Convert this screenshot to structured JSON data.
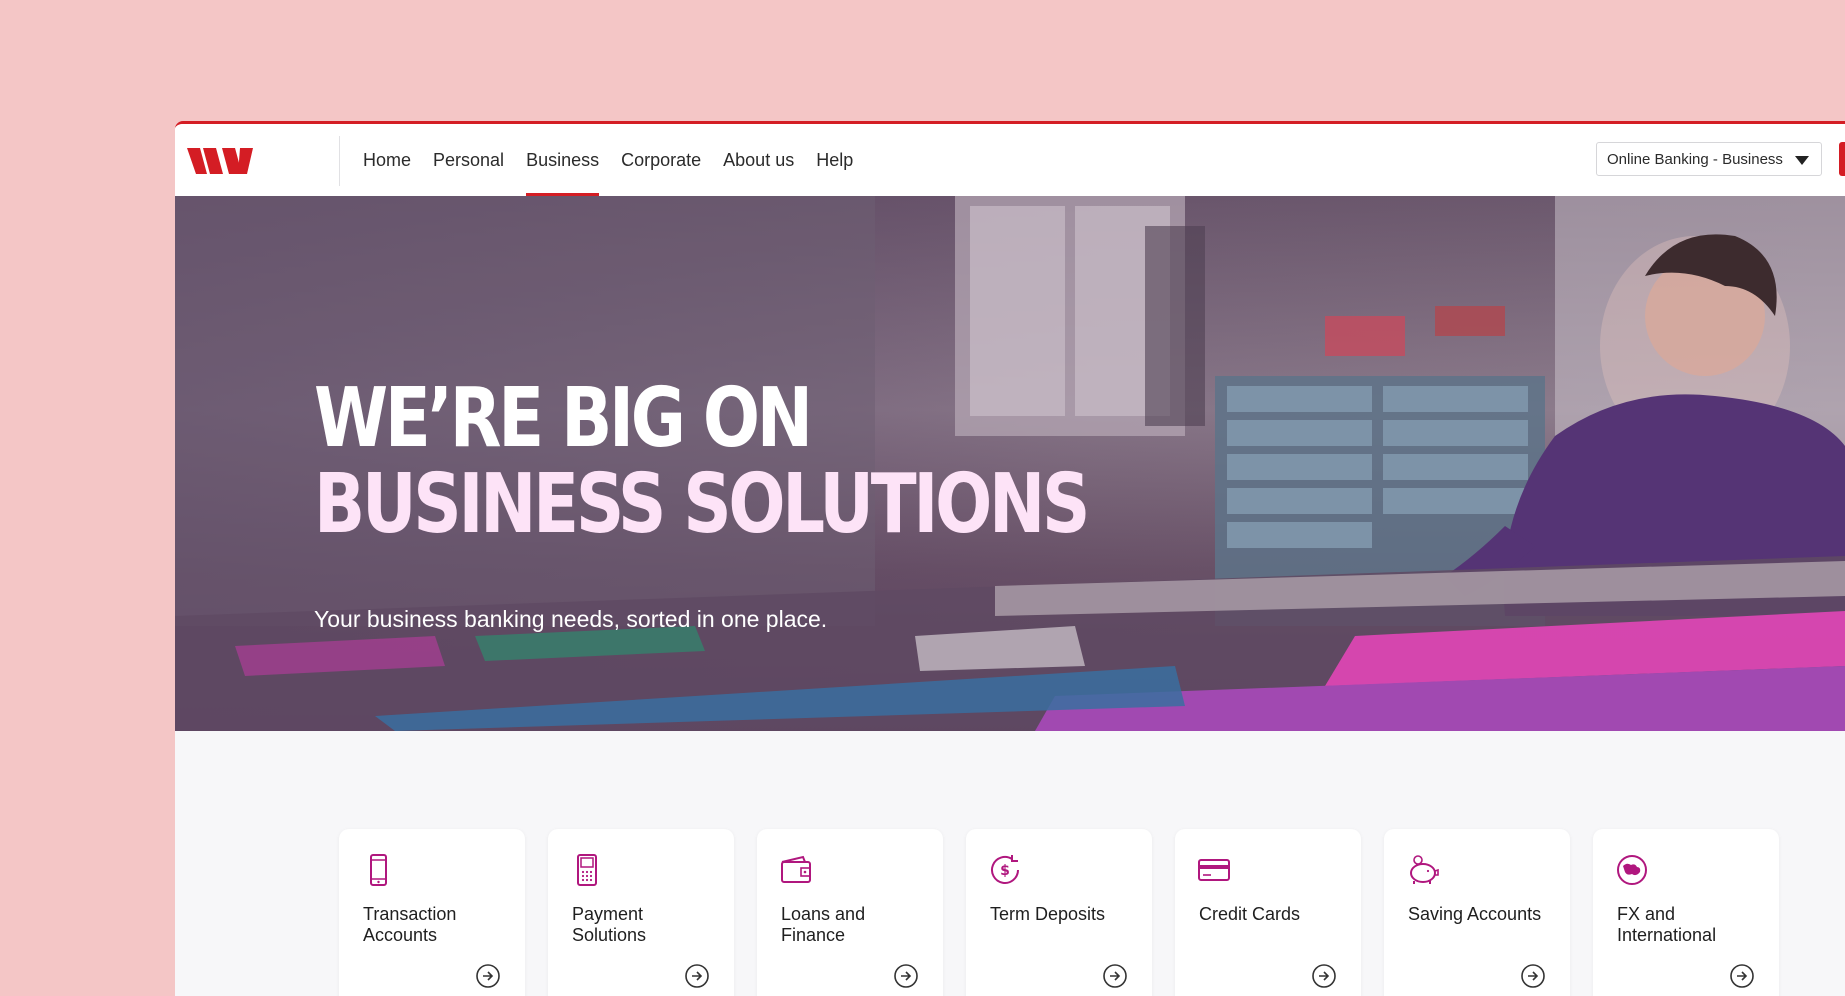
{
  "nav": {
    "links": [
      "Home",
      "Personal",
      "Business",
      "Corporate",
      "About us",
      "Help"
    ],
    "active": "Business",
    "online_banking_select": "Online Banking - Business"
  },
  "hero": {
    "title_line1": "WE’RE BIG ON",
    "title_line2": "BUSINESS SOLUTIONS",
    "subtitle": "Your business banking needs, sorted in one place."
  },
  "cards": [
    {
      "label": "Transaction Accounts",
      "icon": "mobile-phone-icon"
    },
    {
      "label": "Payment Solutions",
      "icon": "payment-terminal-icon"
    },
    {
      "label": "Loans and Finance",
      "icon": "wallet-icon"
    },
    {
      "label": "Term Deposits",
      "icon": "dollar-cycle-icon"
    },
    {
      "label": "Credit Cards",
      "icon": "credit-card-icon"
    },
    {
      "label": "Saving Accounts",
      "icon": "piggy-bank-icon"
    },
    {
      "label": "FX and International",
      "icon": "globe-icon"
    }
  ],
  "colors": {
    "brand_red": "#d41d24",
    "icon_magenta": "#b0177e",
    "page_background": "#f4c6c6"
  }
}
